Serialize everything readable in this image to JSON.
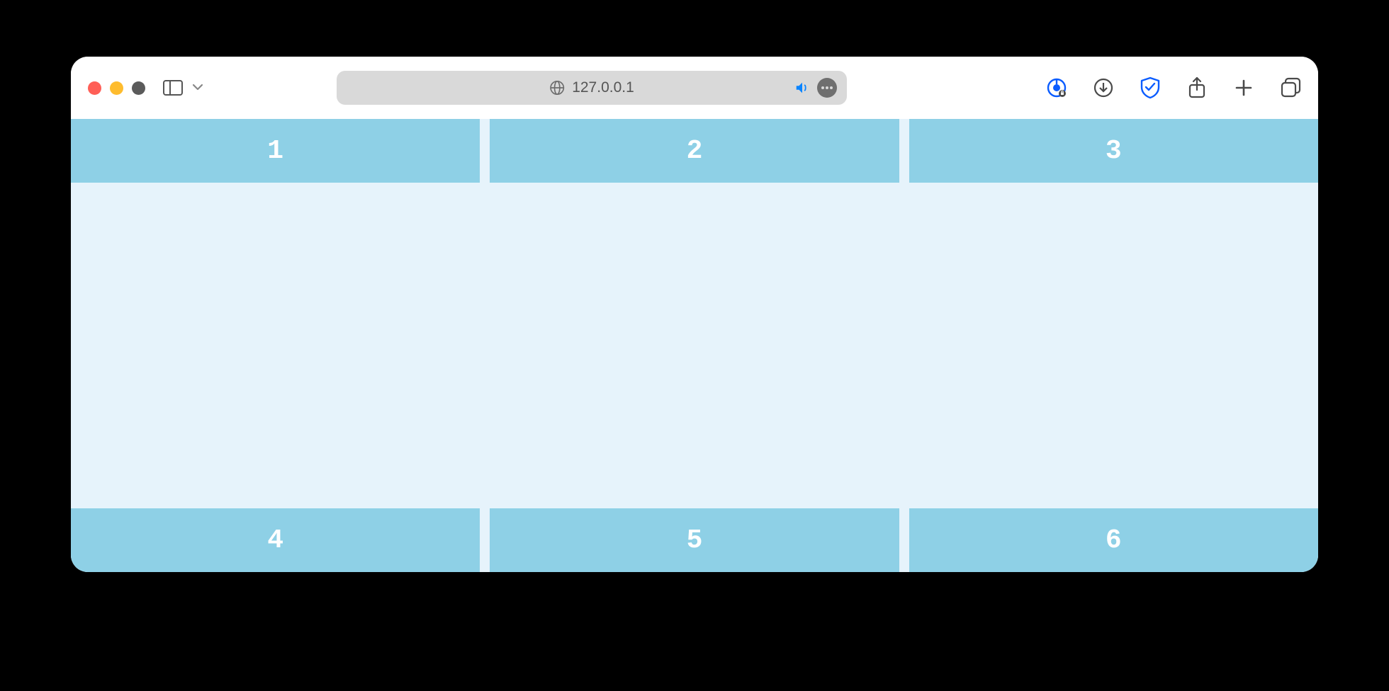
{
  "browser": {
    "address": "127.0.0.1"
  },
  "grid": {
    "top_row": [
      "1",
      "2",
      "3"
    ],
    "bottom_row": [
      "4",
      "5",
      "6"
    ]
  },
  "colors": {
    "cell_bg": "#8ed0e6",
    "content_bg": "#e6f3fb",
    "cell_text": "#ffffff"
  }
}
